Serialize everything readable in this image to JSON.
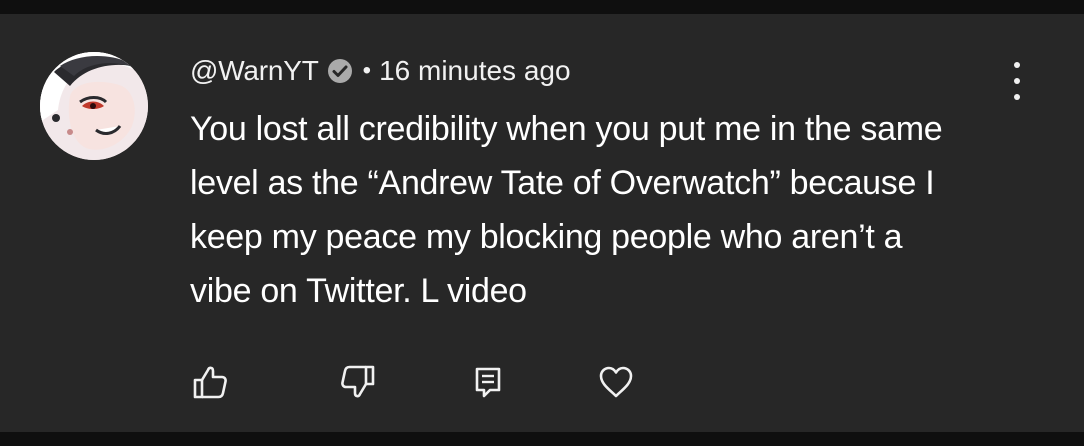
{
  "comment": {
    "author": "@WarnYT",
    "separator": "•",
    "timestamp": "16 minutes ago",
    "text": "You lost all credibility when you put me in the same level as the “Andrew Tate of Overwatch” because I keep my peace my blocking people who aren’t a vibe on Twitter. L video",
    "author_verified": true
  },
  "actions": {
    "icons": [
      "thumbs-up-icon",
      "thumbs-down-icon",
      "reply-icon",
      "heart-icon"
    ]
  },
  "menu": {
    "icon": "more-vertical-icon"
  },
  "colors": {
    "background": "#0f0f0f",
    "card": "#272727",
    "text": "#f1f1f1",
    "verified": "#aaaaaa"
  }
}
